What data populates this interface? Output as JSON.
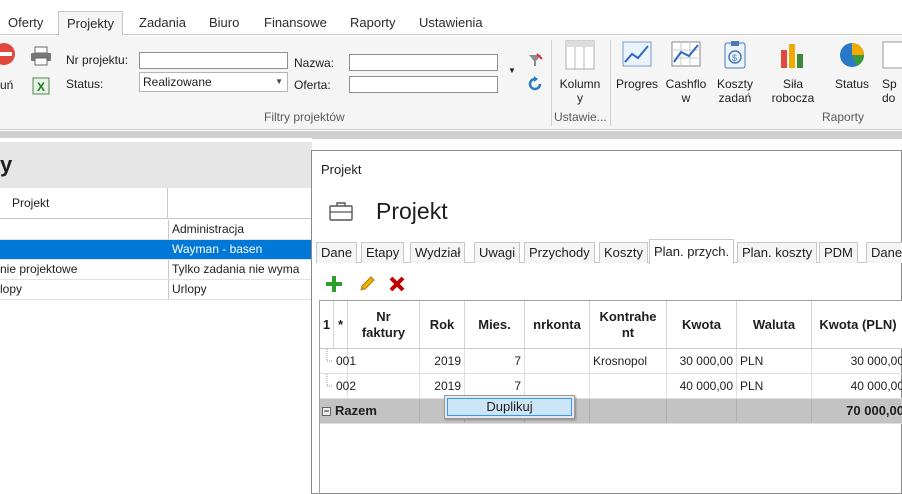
{
  "menu": {
    "tabs": [
      {
        "label": "Oferty"
      },
      {
        "label": "Projekty"
      },
      {
        "label": "Zadania"
      },
      {
        "label": "Biuro"
      },
      {
        "label": "Finansowe"
      },
      {
        "label": "Raporty"
      },
      {
        "label": "Ustawienia"
      }
    ],
    "active": "Projekty"
  },
  "ribbon": {
    "delete_partial": "uń",
    "filters": {
      "nr_label": "Nr projektu:",
      "nr_value": "",
      "status_label": "Status:",
      "status_value": "Realizowane",
      "nazwa_label": "Nazwa:",
      "nazwa_value": "",
      "oferta_label": "Oferta:",
      "oferta_value": "",
      "caption": "Filtry projektów"
    },
    "settings": {
      "kolumny_label": "Kolumn\ny",
      "caption": "Ustawie..."
    },
    "reports": {
      "progres": "Progres",
      "cashflow": "Cashflo\nw",
      "koszty": "Koszty\nzadań",
      "sila": "Siła\nrobocza",
      "status": "Status",
      "sp_partial": "Sp\ndo",
      "caption": "Raporty"
    }
  },
  "left": {
    "title_partial": "y",
    "col_projekt": "Projekt",
    "rows": [
      {
        "c1": "",
        "c2": "Administracja"
      },
      {
        "c1": "",
        "c2": "Wayman - basen"
      },
      {
        "c1": "nie projektowe",
        "c2": "Tylko zadania nie wyma"
      },
      {
        "c1": "lopy",
        "c2": "Urlopy"
      }
    ]
  },
  "dialog": {
    "title": "Projekt",
    "heading": "Projekt",
    "tabs": [
      {
        "label": "Dane"
      },
      {
        "label": "Etapy"
      },
      {
        "label": "Wydział"
      },
      {
        "label": "Uwagi"
      },
      {
        "label": "Przychody"
      },
      {
        "label": "Koszty"
      },
      {
        "label": "Plan. przych."
      },
      {
        "label": "Plan. koszty"
      },
      {
        "label": "PDM"
      },
      {
        "label": "Dane"
      }
    ],
    "active_tab": "Plan. przych.",
    "grid": {
      "headers": {
        "idx": "1",
        "star": "*",
        "nr": "Nr\nfaktury",
        "rok": "Rok",
        "mies": "Mies.",
        "konta": "nrkonta",
        "kontrahent": "Kontrahe\nnt",
        "kwota": "Kwota",
        "waluta": "Waluta",
        "kwota_pln": "Kwota (PLN)"
      },
      "rows": [
        {
          "nr": "001",
          "rok": "2019",
          "mies": "7",
          "konta": "",
          "kontrahent": "Krosnopol",
          "kwota": "30 000,00",
          "waluta": "PLN",
          "kwota_pln": "30 000,00"
        },
        {
          "nr": "002",
          "rok": "2019",
          "mies": "7",
          "konta": "",
          "kontrahent": "",
          "kwota": "40 000,00",
          "waluta": "PLN",
          "kwota_pln": "40 000,00"
        }
      ],
      "total_label": "Razem",
      "total_pln": "70 000,00"
    },
    "context_menu": {
      "item": "Duplikuj"
    }
  },
  "colors": {
    "selection": "#0078d7",
    "add": "#2e9e2e",
    "delete": "#c00000"
  }
}
